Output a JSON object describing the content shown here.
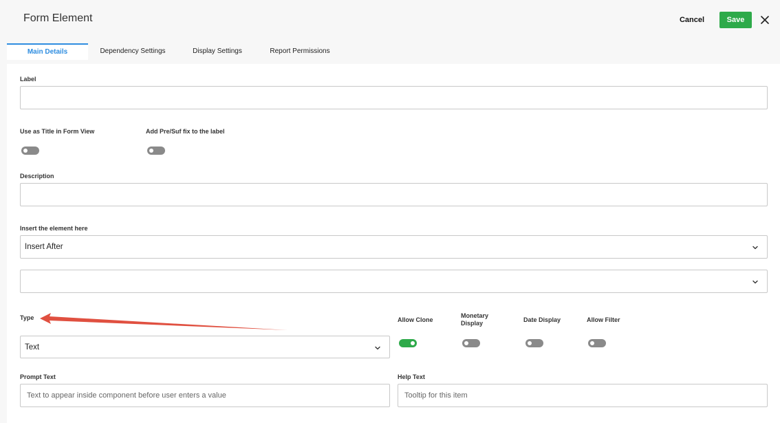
{
  "header": {
    "title": "Form Element",
    "cancel_label": "Cancel",
    "save_label": "Save"
  },
  "tabs": [
    {
      "label": "Main Details",
      "active": true
    },
    {
      "label": "Dependency Settings",
      "active": false
    },
    {
      "label": "Display Settings",
      "active": false
    },
    {
      "label": "Report Permissions",
      "active": false
    }
  ],
  "form": {
    "label": {
      "label": "Label",
      "value": ""
    },
    "use_as_title": {
      "label": "Use as Title in Form View",
      "on": false
    },
    "add_presuffix": {
      "label": "Add Pre/Suf fix to the label",
      "on": false
    },
    "description": {
      "label": "Description",
      "value": ""
    },
    "insert_position": {
      "label": "Insert the element here",
      "selected": "Insert After"
    },
    "insert_target": {
      "selected": ""
    },
    "type": {
      "label": "Type",
      "selected": "Text"
    },
    "allow_clone": {
      "label": "Allow Clone",
      "on": true
    },
    "monetary_display": {
      "label": "Monetary Display",
      "on": false
    },
    "date_display": {
      "label": "Date Display",
      "on": false
    },
    "allow_filter": {
      "label": "Allow Filter",
      "on": false
    },
    "prompt_text": {
      "label": "Prompt Text",
      "placeholder": "Text to appear inside component before user enters a value"
    },
    "help_text": {
      "label": "Help Text",
      "placeholder": "Tooltip for this item"
    }
  },
  "colors": {
    "accent": "#2e8de0",
    "save": "#2eaa4a",
    "annotation_arrow": "#e05040"
  },
  "icons": {
    "close": "close-icon",
    "chevron": "chevron-down-icon",
    "arrow": "annotation-arrow-icon"
  }
}
